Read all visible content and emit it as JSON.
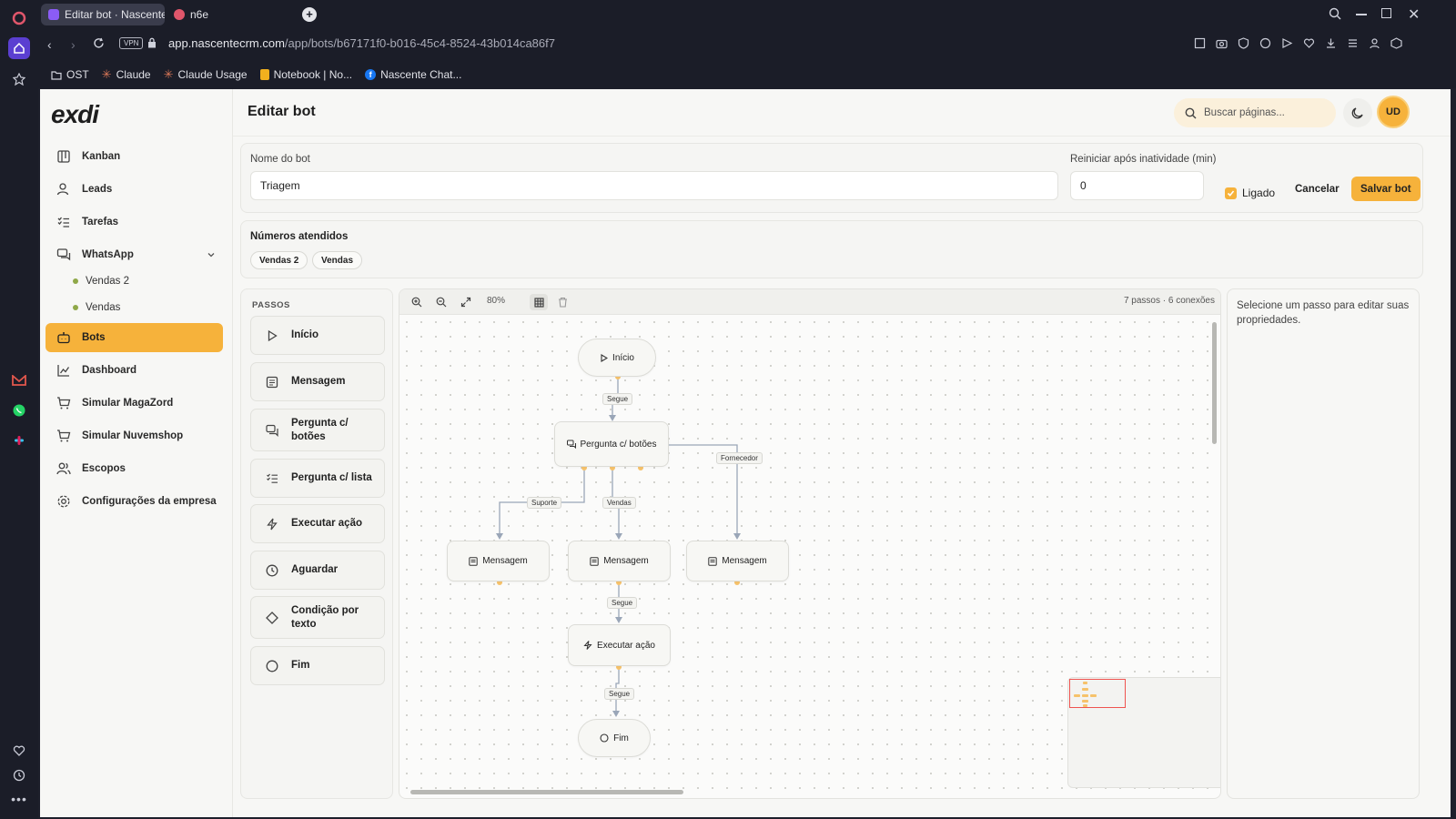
{
  "browser": {
    "tabs": [
      {
        "title": "Editar bot · Nascente",
        "active": true
      },
      {
        "title": "n6e",
        "active": false
      }
    ],
    "url_domain": "app.nascentecrm.com",
    "url_path": "/app/bots/b67171f0-b016-45c4-8524-43b014ca86f7",
    "vpn_label": "VPN",
    "bookmarks": [
      {
        "label": "OST",
        "icon": "folder-icon"
      },
      {
        "label": "Claude",
        "icon": "claude-icon"
      },
      {
        "label": "Claude Usage",
        "icon": "claude-icon"
      },
      {
        "label": "Notebook | No...",
        "icon": "notebook-icon"
      },
      {
        "label": "Nascente Chat...",
        "icon": "facebook-icon"
      }
    ]
  },
  "app": {
    "logo": "exdi",
    "header_title": "Editar bot",
    "search_placeholder": "Buscar páginas...",
    "avatar_initials": "UD",
    "accent_color": "#f6b23b"
  },
  "sidebar": {
    "items": [
      {
        "label": "Kanban",
        "icon": "kanban-icon"
      },
      {
        "label": "Leads",
        "icon": "leads-icon"
      },
      {
        "label": "Tarefas",
        "icon": "tasks-icon"
      },
      {
        "label": "WhatsApp",
        "icon": "chat-icon"
      },
      {
        "label": "Bots",
        "icon": "bot-icon",
        "active": true
      },
      {
        "label": "Dashboard",
        "icon": "chart-icon"
      },
      {
        "label": "Simular MagaZord",
        "icon": "cart-icon"
      },
      {
        "label": "Simular Nuvemshop",
        "icon": "cart-icon"
      },
      {
        "label": "Escopos",
        "icon": "users-icon"
      },
      {
        "label": "Configurações da empresa",
        "icon": "gear-icon"
      }
    ],
    "whatsapp_subitems": [
      "Vendas 2",
      "Vendas"
    ]
  },
  "form": {
    "name_label": "Nome do bot",
    "name_value": "Triagem",
    "restart_label": "Reiniciar após inatividade (min)",
    "restart_value": "0",
    "enabled_label": "Ligado",
    "enabled": true,
    "cancel_label": "Cancelar",
    "save_label": "Salvar bot"
  },
  "numbers": {
    "title": "Números atendidos",
    "chips": [
      "Vendas 2",
      "Vendas"
    ]
  },
  "steps_panel": {
    "title": "PASSOS",
    "steps": [
      {
        "label": "Início",
        "icon": "play-icon"
      },
      {
        "label": "Mensagem",
        "icon": "message-icon"
      },
      {
        "label": "Pergunta c/ botões",
        "icon": "question-buttons-icon"
      },
      {
        "label": "Pergunta c/ lista",
        "icon": "list-icon"
      },
      {
        "label": "Executar ação",
        "icon": "bolt-icon"
      },
      {
        "label": "Aguardar",
        "icon": "clock-icon"
      },
      {
        "label": "Condição por texto",
        "icon": "diamond-icon"
      },
      {
        "label": "Fim",
        "icon": "circle-icon"
      }
    ]
  },
  "canvas": {
    "zoom": "80%",
    "stats": "7 passos · 6 conexões",
    "nodes": {
      "start": "Início",
      "question": "Pergunta c/ botões",
      "msg1": "Mensagem",
      "msg2": "Mensagem",
      "msg3": "Mensagem",
      "action": "Executar ação",
      "end": "Fim"
    },
    "edges": {
      "segue1": "Segue",
      "suporte": "Suporte",
      "vendas": "Vendas",
      "fornecedor": "Fornecedor",
      "segue2": "Segue",
      "segue3": "Segue"
    }
  },
  "properties": {
    "hint": "Selecione um passo para editar suas propriedades."
  }
}
